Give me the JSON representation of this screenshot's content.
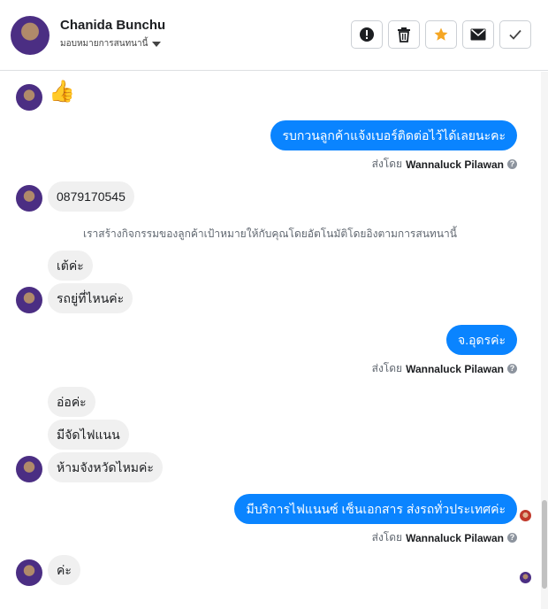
{
  "header": {
    "name": "Chanida Bunchu",
    "assign_label": "มอบหมายการสนทนานี้"
  },
  "toolbar": {
    "buttons": [
      "alert-icon",
      "trash-icon",
      "star-icon",
      "mail-icon",
      "check-icon"
    ],
    "star_color": "#f5a623"
  },
  "messages": {
    "m1_emoji": "👍",
    "m2_out": "รบกวนลูกค้าแจ้งเบอร์ติดต่อไว้ได้เลยนะคะ",
    "sent_prefix": "ส่งโดย",
    "agent": "Wannaluck Pilawan",
    "m3_in": "0879170545",
    "system_note": "เราสร้างกิจกรรมของลูกค้าเป้าหมายให้กับคุณโดยอัตโนมัติโดยอิงตามการสนทนานี้",
    "m4_in": "เต้ค่ะ",
    "m5_in": "รถยู่ที่ไหนค่ะ",
    "m6_out": "จ.อุดรค่ะ",
    "m7_in": "อ่อค่ะ",
    "m8_in": "มีจัดไฟแนน",
    "m9_in": "ห้ามจังหวัดไหมค่ะ",
    "m10_out": "มีบริการไฟแนนซ์ เซ็นเอกสาร ส่งรถทั่วประเทศค่ะ",
    "m11_in": "ค่ะ"
  },
  "colors": {
    "outgoing_bubble": "#0a84ff",
    "incoming_bubble": "#f0f0f0"
  }
}
